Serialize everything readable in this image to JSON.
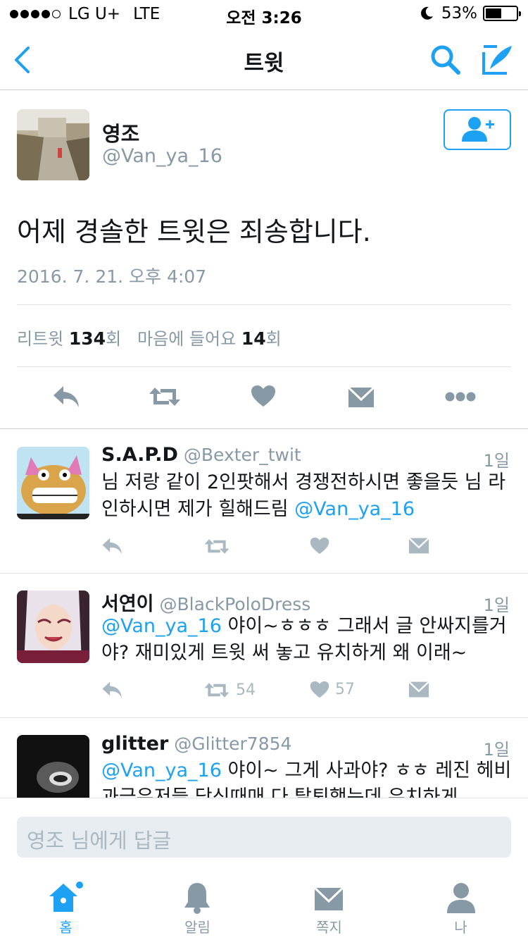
{
  "status_bar": {
    "carrier": "LG U+",
    "network": "LTE",
    "time": "오전 3:26",
    "battery": "53%",
    "battery_level": 0.53
  },
  "nav": {
    "title": "트윗",
    "back_icon": "chevron-left-icon",
    "search_icon": "search-icon",
    "compose_icon": "compose-quill-icon",
    "accent": "#1da1f2"
  },
  "tweet": {
    "name": "영조",
    "handle": "@Van_ya_16",
    "text": "어제 경솔한 트윗은 죄송합니다.",
    "date": "2016. 7. 21. 오후 4:07",
    "retweet_label": "리트윗",
    "retweet_count": "134",
    "count_suffix": "회",
    "like_label": "마음에 들어요",
    "like_count": "14"
  },
  "replies": [
    {
      "name": "S.A.P.D",
      "handle": "@Bexter_twit",
      "time": "1일",
      "text": "님 저랑 같이 2인팟해서 경쟁전하시면 좋을듯 님 라인하시면 제가 힐해드림 ",
      "mention": "@Van_ya_16",
      "retweets": "",
      "likes": ""
    },
    {
      "name": "서연이",
      "handle": "@BlackPoloDress",
      "time": "1일",
      "mention": "@Van_ya_16",
      "text": " 야이~ㅎㅎㅎ 그래서 글 안싸지를거야? 재미있게 트윗 써 놓고 유치하게 왜 이래~",
      "retweets": "54",
      "likes": "57"
    },
    {
      "name": "glitter",
      "handle": "@Glitter7854",
      "time": "1일",
      "mention": "@Van_ya_16",
      "text": " 야이~ 그게 사과야? ㅎㅎ 레진 헤비과금유저들 당신때매 다 탈퇴했는데 유치하게"
    }
  ],
  "composer": {
    "placeholder": "영조 님에게 답글"
  },
  "tabs": [
    {
      "label": "홈",
      "icon": "home-icon",
      "active": true
    },
    {
      "label": "알림",
      "icon": "bell-icon",
      "active": false
    },
    {
      "label": "쪽지",
      "icon": "envelope-icon",
      "active": false
    },
    {
      "label": "나",
      "icon": "person-icon",
      "active": false
    }
  ]
}
